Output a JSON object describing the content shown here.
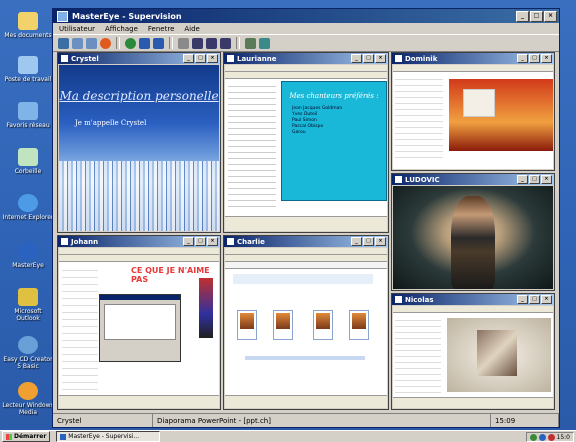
{
  "desktop": {
    "icons": [
      {
        "label": "Mes documents",
        "color": "#f2d36b"
      },
      {
        "label": "Poste de travail",
        "color": "#9ec8f0"
      },
      {
        "label": "Favoris réseau",
        "color": "#7fb4e8"
      },
      {
        "label": "Corbeille",
        "color": "#bfe4bf"
      },
      {
        "label": "Internet Explorer",
        "color": "#4d9be6"
      },
      {
        "label": "MasterEye",
        "color": "#2a62c0"
      },
      {
        "label": "Microsoft Outlook",
        "color": "#e0c040"
      },
      {
        "label": "Easy CD Creator 5 Basic",
        "color": "#6aa0d8"
      },
      {
        "label": "Lecteur Windows Media",
        "color": "#f0a030"
      }
    ]
  },
  "app": {
    "title": "MasterEye - Supervision",
    "menu": [
      "Utilisateur",
      "Affichage",
      "Fenetre",
      "Aide"
    ],
    "window_buttons": [
      "_",
      "□",
      "×"
    ],
    "toolbar_icons": [
      "save-icon",
      "grid-icon",
      "grid2-icon",
      "stop-icon",
      "refresh-icon",
      "back-icon",
      "forward-icon",
      "print-icon",
      "layout1-icon",
      "layout2-icon",
      "layout3-icon",
      "pin-icon",
      "network-icon"
    ]
  },
  "panes": {
    "crystel": {
      "title": "Crystel",
      "heading": "Ma description personelle",
      "subtitle": "Je m'appelle Crystel"
    },
    "laurianne": {
      "title": "Laurianne",
      "slide_title": "Mes chanteurs préférés :",
      "slide_lines": [
        "Jean Jacques Goldman",
        "Yves Duteil",
        "Paul Simon",
        "Pascal Obispo",
        "Garou"
      ]
    },
    "dominik": {
      "title": "Dominik"
    },
    "ludovic": {
      "title": "LUDOVIC"
    },
    "johann": {
      "title": "Johann",
      "red_title": "CE QUE JE N'AIME PAS"
    },
    "charlie": {
      "title": "Charlie"
    },
    "nicolas": {
      "title": "Nicolas"
    }
  },
  "statusbar": {
    "user": "Crystel",
    "app": "Diaporama PowerPoint - [ppt.ch]",
    "time": "15:09"
  },
  "taskbar": {
    "start": "Démarrer",
    "task": "MasterEye - Supervisi...",
    "clock": "15:0"
  }
}
